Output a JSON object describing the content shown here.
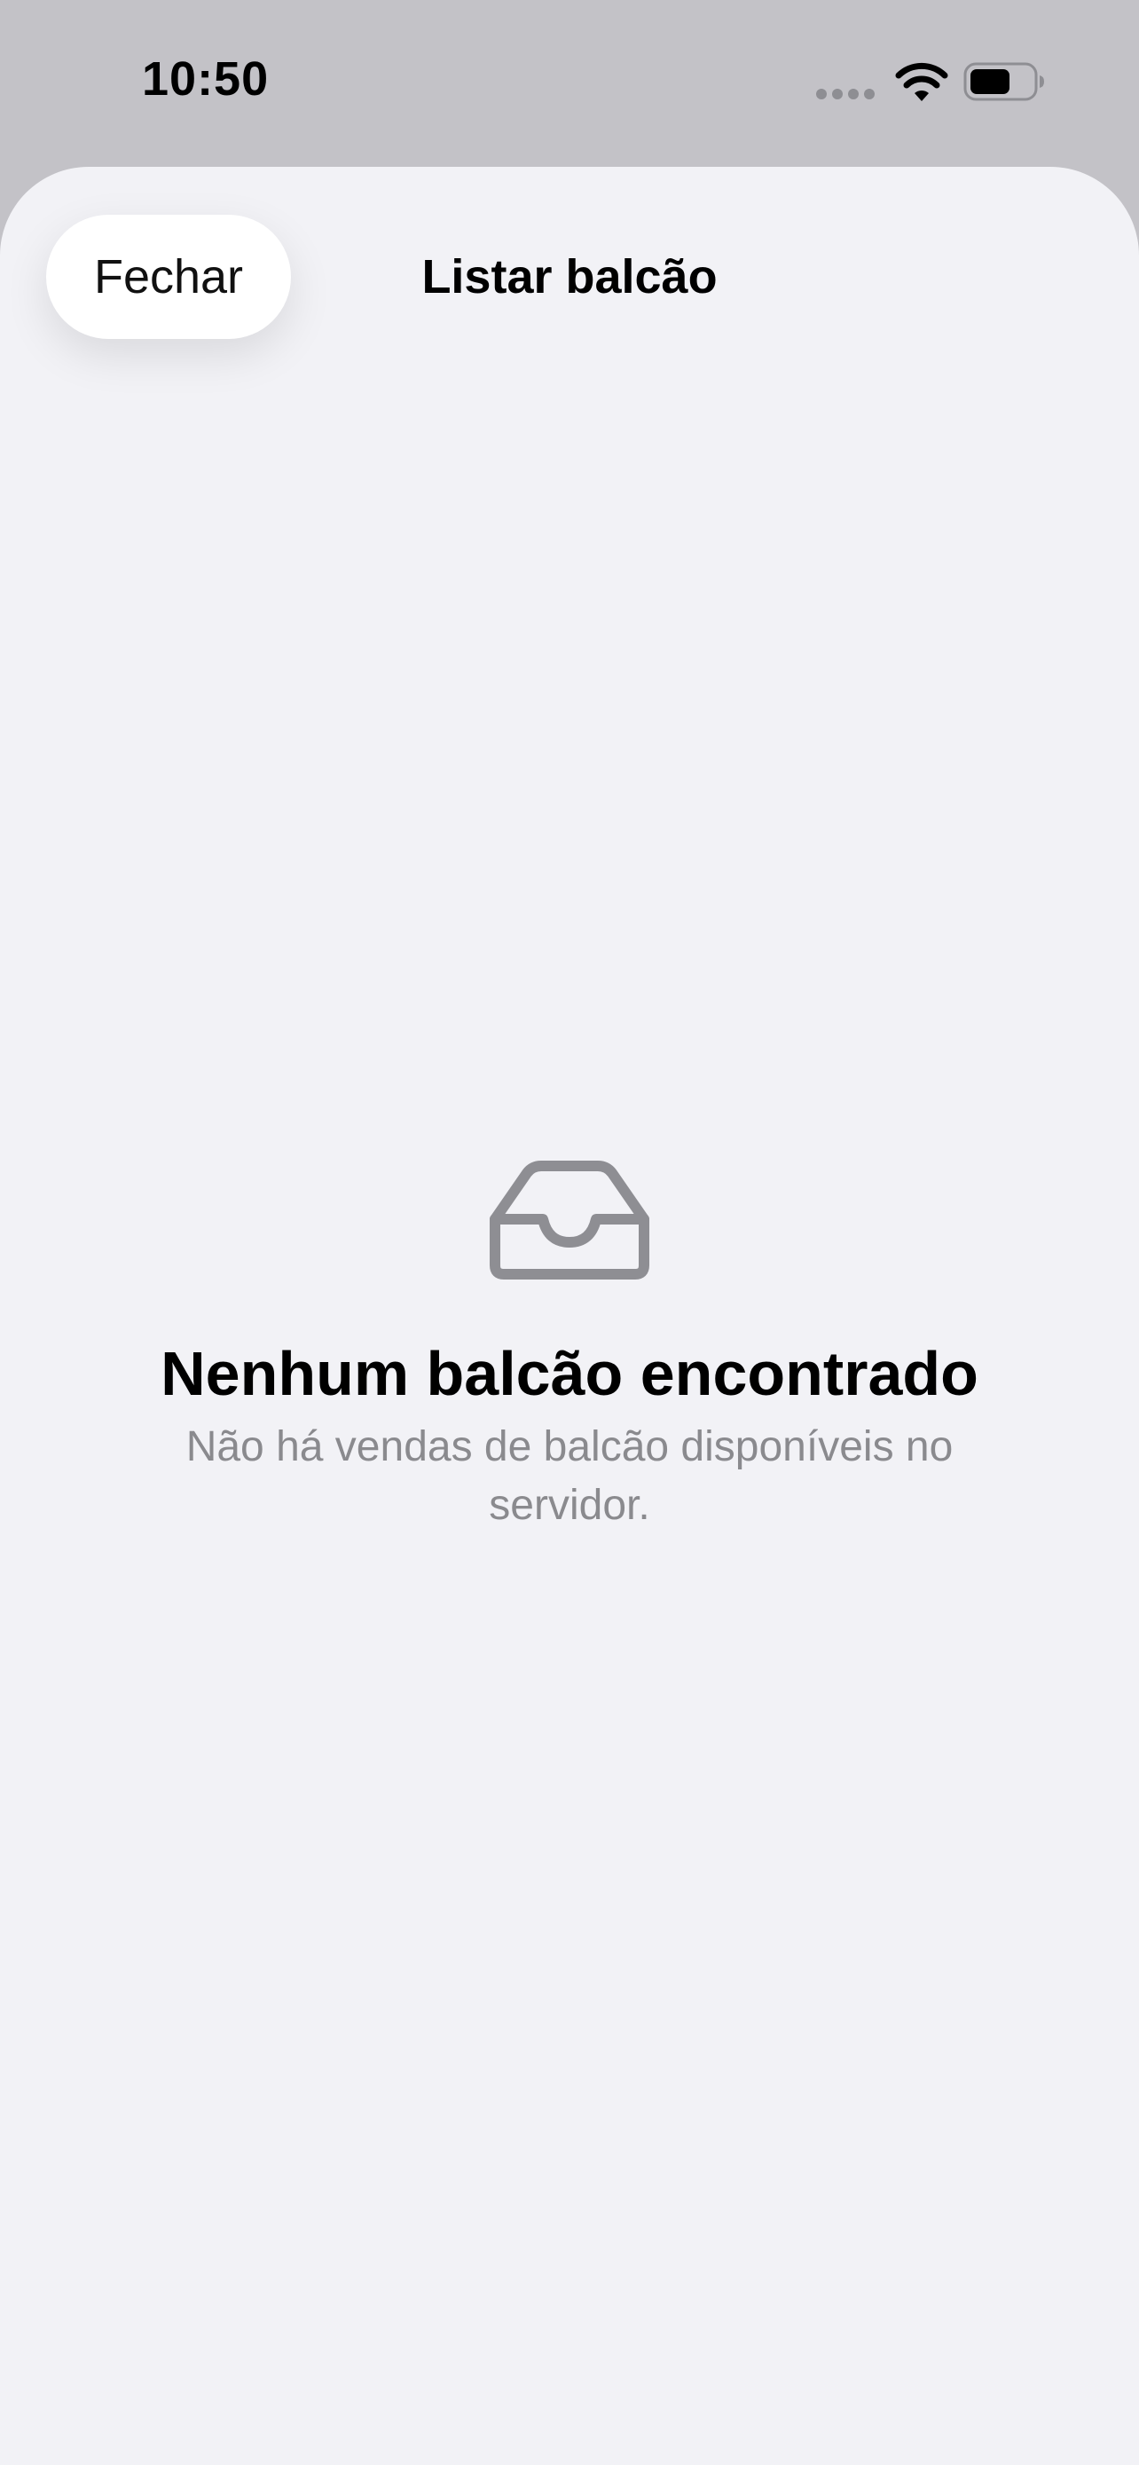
{
  "status_bar": {
    "time": "10:50"
  },
  "icons": {
    "signal": "cellular-signal-icon",
    "wifi": "wifi-icon",
    "battery": "battery-icon",
    "empty": "inbox-tray-icon"
  },
  "navigation": {
    "close_label": "Fechar",
    "title": "Listar balcão"
  },
  "empty_state": {
    "title": "Nenhum balcão encontrado",
    "message": "Não há vendas de balcão disponíveis no servidor."
  },
  "colors": {
    "background": "#c3c2c7",
    "sheet": "#f2f2f6",
    "secondary_text": "#8a8a8e",
    "icon": "#8e8e93"
  }
}
